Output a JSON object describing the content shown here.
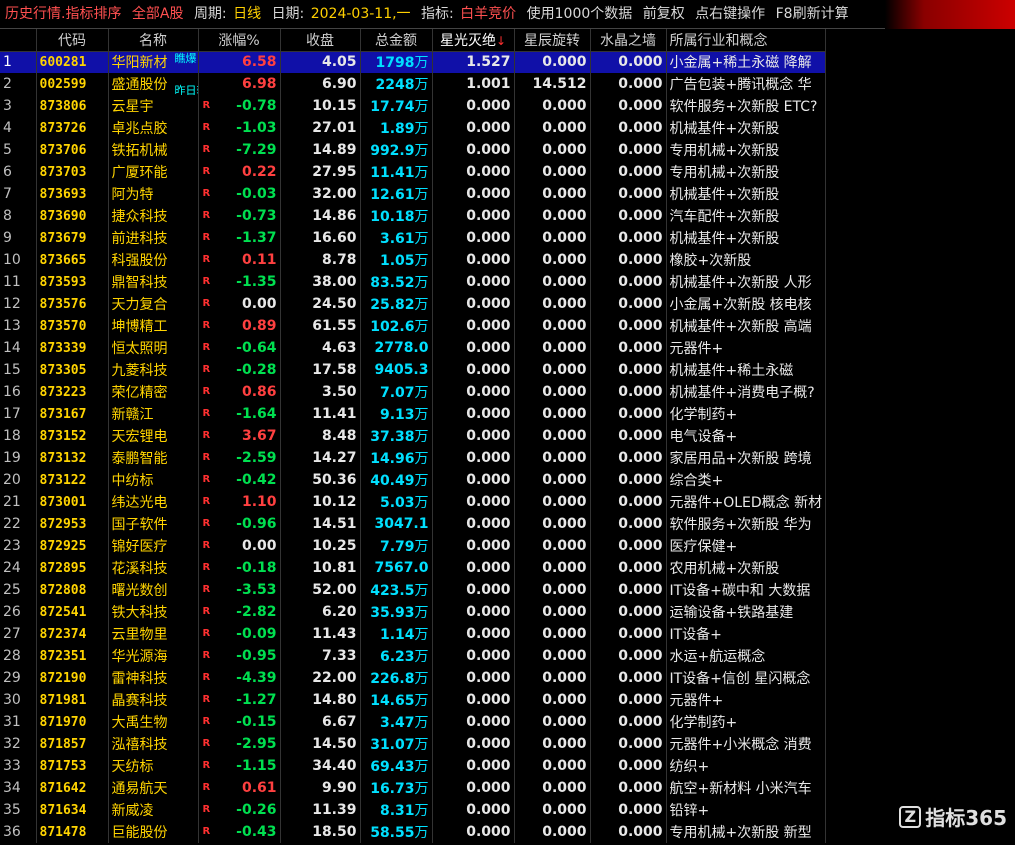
{
  "titlebar": {
    "section": "历史行情.指标排序",
    "market": "全部A股",
    "period_label": "周期:",
    "period_value": "日线",
    "date_label": "日期:",
    "date_value": "2024-03-11,一",
    "indicator_label": "指标:",
    "indicator_value": "白羊竞价",
    "data_count": "使用1000个数据",
    "adjust": "前复权",
    "rightclick": "点右键操作",
    "refresh": "F8刷新计算"
  },
  "columns": {
    "code": "代码",
    "name": "名称",
    "change": "涨幅%",
    "close": "收盘",
    "amount": "总金额",
    "c1": "星光灭绝",
    "c2": "星辰旋转",
    "c3": "水晶之墙",
    "industry": "所属行业和概念"
  },
  "sort_arrow": "↓",
  "r_flag": "R",
  "unit_wan": "万",
  "row1_tags": {
    "tag1": "瞧爆",
    "tag2": "昨日较弱"
  },
  "colors": {
    "up": "#ff4040",
    "down": "#00e050",
    "selected_row": "#1010a8",
    "code": "#ffd400",
    "amount": "#00e0ff"
  },
  "rows": [
    {
      "idx": "1",
      "code": "600281",
      "name": "华阳新材",
      "chg": "6.58",
      "dir": "up",
      "close": "4.05",
      "amt": "1798",
      "unit": "万",
      "c1": "1.527",
      "c2": "0.000",
      "c3": "0.000",
      "ind": "小金属+稀土永磁 降解",
      "r": false
    },
    {
      "idx": "2",
      "code": "002599",
      "name": "盛通股份",
      "chg": "6.98",
      "dir": "up",
      "close": "6.90",
      "amt": "2248",
      "unit": "万",
      "c1": "1.001",
      "c2": "14.512",
      "c3": "0.000",
      "ind": "广告包装+腾讯概念 华",
      "r": false
    },
    {
      "idx": "3",
      "code": "873806",
      "name": "云星宇",
      "chg": "-0.78",
      "dir": "down",
      "close": "10.15",
      "amt": "17.74",
      "unit": "万",
      "c1": "0.000",
      "c2": "0.000",
      "c3": "0.000",
      "ind": "软件服务+次新股 ETC?",
      "r": true
    },
    {
      "idx": "4",
      "code": "873726",
      "name": "卓兆点胶",
      "chg": "-1.03",
      "dir": "down",
      "close": "27.01",
      "amt": "1.89",
      "unit": "万",
      "c1": "0.000",
      "c2": "0.000",
      "c3": "0.000",
      "ind": "机械基件+次新股",
      "r": true
    },
    {
      "idx": "5",
      "code": "873706",
      "name": "铁拓机械",
      "chg": "-7.29",
      "dir": "down",
      "close": "14.89",
      "amt": "992.9",
      "unit": "万",
      "c1": "0.000",
      "c2": "0.000",
      "c3": "0.000",
      "ind": "专用机械+次新股",
      "r": true
    },
    {
      "idx": "6",
      "code": "873703",
      "name": "广厦环能",
      "chg": "0.22",
      "dir": "up",
      "close": "27.95",
      "amt": "11.41",
      "unit": "万",
      "c1": "0.000",
      "c2": "0.000",
      "c3": "0.000",
      "ind": "专用机械+次新股",
      "r": true
    },
    {
      "idx": "7",
      "code": "873693",
      "name": "阿为特",
      "chg": "-0.03",
      "dir": "down",
      "close": "32.00",
      "amt": "12.61",
      "unit": "万",
      "c1": "0.000",
      "c2": "0.000",
      "c3": "0.000",
      "ind": "机械基件+次新股",
      "r": true
    },
    {
      "idx": "8",
      "code": "873690",
      "name": "捷众科技",
      "chg": "-0.73",
      "dir": "down",
      "close": "14.86",
      "amt": "10.18",
      "unit": "万",
      "c1": "0.000",
      "c2": "0.000",
      "c3": "0.000",
      "ind": "汽车配件+次新股",
      "r": true
    },
    {
      "idx": "9",
      "code": "873679",
      "name": "前进科技",
      "chg": "-1.37",
      "dir": "down",
      "close": "16.60",
      "amt": "3.61",
      "unit": "万",
      "c1": "0.000",
      "c2": "0.000",
      "c3": "0.000",
      "ind": "机械基件+次新股",
      "r": true
    },
    {
      "idx": "10",
      "code": "873665",
      "name": "科强股份",
      "chg": "0.11",
      "dir": "up",
      "close": "8.78",
      "amt": "1.05",
      "unit": "万",
      "c1": "0.000",
      "c2": "0.000",
      "c3": "0.000",
      "ind": "橡胶+次新股",
      "r": true
    },
    {
      "idx": "11",
      "code": "873593",
      "name": "鼎智科技",
      "chg": "-1.35",
      "dir": "down",
      "close": "38.00",
      "amt": "83.52",
      "unit": "万",
      "c1": "0.000",
      "c2": "0.000",
      "c3": "0.000",
      "ind": "机械基件+次新股 人形",
      "r": true
    },
    {
      "idx": "12",
      "code": "873576",
      "name": "天力复合",
      "chg": "0.00",
      "dir": "flat",
      "close": "24.50",
      "amt": "25.82",
      "unit": "万",
      "c1": "0.000",
      "c2": "0.000",
      "c3": "0.000",
      "ind": "小金属+次新股 核电核",
      "r": true
    },
    {
      "idx": "13",
      "code": "873570",
      "name": "坤博精工",
      "chg": "0.89",
      "dir": "up",
      "close": "61.55",
      "amt": "102.6",
      "unit": "万",
      "c1": "0.000",
      "c2": "0.000",
      "c3": "0.000",
      "ind": "机械基件+次新股 高端",
      "r": true
    },
    {
      "idx": "14",
      "code": "873339",
      "name": "恒太照明",
      "chg": "-0.64",
      "dir": "down",
      "close": "4.63",
      "amt": "2778.0",
      "unit": "",
      "c1": "0.000",
      "c2": "0.000",
      "c3": "0.000",
      "ind": "元器件+",
      "r": true
    },
    {
      "idx": "15",
      "code": "873305",
      "name": "九菱科技",
      "chg": "-0.28",
      "dir": "down",
      "close": "17.58",
      "amt": "9405.3",
      "unit": "",
      "c1": "0.000",
      "c2": "0.000",
      "c3": "0.000",
      "ind": "机械基件+稀土永磁",
      "r": true
    },
    {
      "idx": "16",
      "code": "873223",
      "name": "荣亿精密",
      "chg": "0.86",
      "dir": "up",
      "close": "3.50",
      "amt": "7.07",
      "unit": "万",
      "c1": "0.000",
      "c2": "0.000",
      "c3": "0.000",
      "ind": "机械基件+消费电子概?",
      "r": true
    },
    {
      "idx": "17",
      "code": "873167",
      "name": "新赣江",
      "chg": "-1.64",
      "dir": "down",
      "close": "11.41",
      "amt": "9.13",
      "unit": "万",
      "c1": "0.000",
      "c2": "0.000",
      "c3": "0.000",
      "ind": "化学制药+",
      "r": true
    },
    {
      "idx": "18",
      "code": "873152",
      "name": "天宏锂电",
      "chg": "3.67",
      "dir": "up",
      "close": "8.48",
      "amt": "37.38",
      "unit": "万",
      "c1": "0.000",
      "c2": "0.000",
      "c3": "0.000",
      "ind": "电气设备+",
      "r": true
    },
    {
      "idx": "19",
      "code": "873132",
      "name": "泰鹏智能",
      "chg": "-2.59",
      "dir": "down",
      "close": "14.27",
      "amt": "14.96",
      "unit": "万",
      "c1": "0.000",
      "c2": "0.000",
      "c3": "0.000",
      "ind": "家居用品+次新股 跨境",
      "r": true
    },
    {
      "idx": "20",
      "code": "873122",
      "name": "中纺标",
      "chg": "-0.42",
      "dir": "down",
      "close": "50.36",
      "amt": "40.49",
      "unit": "万",
      "c1": "0.000",
      "c2": "0.000",
      "c3": "0.000",
      "ind": "综合类+",
      "r": true
    },
    {
      "idx": "21",
      "code": "873001",
      "name": "纬达光电",
      "chg": "1.10",
      "dir": "up",
      "close": "10.12",
      "amt": "5.03",
      "unit": "万",
      "c1": "0.000",
      "c2": "0.000",
      "c3": "0.000",
      "ind": "元器件+OLED概念 新材",
      "r": true
    },
    {
      "idx": "22",
      "code": "872953",
      "name": "国子软件",
      "chg": "-0.96",
      "dir": "down",
      "close": "14.51",
      "amt": "3047.1",
      "unit": "",
      "c1": "0.000",
      "c2": "0.000",
      "c3": "0.000",
      "ind": "软件服务+次新股 华为",
      "r": true
    },
    {
      "idx": "23",
      "code": "872925",
      "name": "锦好医疗",
      "chg": "0.00",
      "dir": "flat",
      "close": "10.25",
      "amt": "7.79",
      "unit": "万",
      "c1": "0.000",
      "c2": "0.000",
      "c3": "0.000",
      "ind": "医疗保健+",
      "r": true
    },
    {
      "idx": "24",
      "code": "872895",
      "name": "花溪科技",
      "chg": "-0.18",
      "dir": "down",
      "close": "10.81",
      "amt": "7567.0",
      "unit": "",
      "c1": "0.000",
      "c2": "0.000",
      "c3": "0.000",
      "ind": "农用机械+次新股",
      "r": true
    },
    {
      "idx": "25",
      "code": "872808",
      "name": "曙光数创",
      "chg": "-3.53",
      "dir": "down",
      "close": "52.00",
      "amt": "423.5",
      "unit": "万",
      "c1": "0.000",
      "c2": "0.000",
      "c3": "0.000",
      "ind": "IT设备+碳中和 大数据",
      "r": true
    },
    {
      "idx": "26",
      "code": "872541",
      "name": "铁大科技",
      "chg": "-2.82",
      "dir": "down",
      "close": "6.20",
      "amt": "35.93",
      "unit": "万",
      "c1": "0.000",
      "c2": "0.000",
      "c3": "0.000",
      "ind": "运输设备+铁路基建",
      "r": true
    },
    {
      "idx": "27",
      "code": "872374",
      "name": "云里物里",
      "chg": "-0.09",
      "dir": "down",
      "close": "11.43",
      "amt": "1.14",
      "unit": "万",
      "c1": "0.000",
      "c2": "0.000",
      "c3": "0.000",
      "ind": "IT设备+",
      "r": true
    },
    {
      "idx": "28",
      "code": "872351",
      "name": "华光源海",
      "chg": "-0.95",
      "dir": "down",
      "close": "7.33",
      "amt": "6.23",
      "unit": "万",
      "c1": "0.000",
      "c2": "0.000",
      "c3": "0.000",
      "ind": "水运+航运概念",
      "r": true
    },
    {
      "idx": "29",
      "code": "872190",
      "name": "雷神科技",
      "chg": "-4.39",
      "dir": "down",
      "close": "22.00",
      "amt": "226.8",
      "unit": "万",
      "c1": "0.000",
      "c2": "0.000",
      "c3": "0.000",
      "ind": "IT设备+信创 星闪概念",
      "r": true
    },
    {
      "idx": "30",
      "code": "871981",
      "name": "晶赛科技",
      "chg": "-1.27",
      "dir": "down",
      "close": "14.80",
      "amt": "14.65",
      "unit": "万",
      "c1": "0.000",
      "c2": "0.000",
      "c3": "0.000",
      "ind": "元器件+",
      "r": true
    },
    {
      "idx": "31",
      "code": "871970",
      "name": "大禹生物",
      "chg": "-0.15",
      "dir": "down",
      "close": "6.67",
      "amt": "3.47",
      "unit": "万",
      "c1": "0.000",
      "c2": "0.000",
      "c3": "0.000",
      "ind": "化学制药+",
      "r": true
    },
    {
      "idx": "32",
      "code": "871857",
      "name": "泓禧科技",
      "chg": "-2.95",
      "dir": "down",
      "close": "14.50",
      "amt": "31.07",
      "unit": "万",
      "c1": "0.000",
      "c2": "0.000",
      "c3": "0.000",
      "ind": "元器件+小米概念 消费",
      "r": true
    },
    {
      "idx": "33",
      "code": "871753",
      "name": "天纺标",
      "chg": "-1.15",
      "dir": "down",
      "close": "34.40",
      "amt": "69.43",
      "unit": "万",
      "c1": "0.000",
      "c2": "0.000",
      "c3": "0.000",
      "ind": "纺织+",
      "r": true
    },
    {
      "idx": "34",
      "code": "871642",
      "name": "通易航天",
      "chg": "0.61",
      "dir": "up",
      "close": "9.90",
      "amt": "16.73",
      "unit": "万",
      "c1": "0.000",
      "c2": "0.000",
      "c3": "0.000",
      "ind": "航空+新材料 小米汽车",
      "r": true
    },
    {
      "idx": "35",
      "code": "871634",
      "name": "新威凌",
      "chg": "-0.26",
      "dir": "down",
      "close": "11.39",
      "amt": "8.31",
      "unit": "万",
      "c1": "0.000",
      "c2": "0.000",
      "c3": "0.000",
      "ind": "铅锌+",
      "r": true
    },
    {
      "idx": "36",
      "code": "871478",
      "name": "巨能股份",
      "chg": "-0.43",
      "dir": "down",
      "close": "18.50",
      "amt": "58.55",
      "unit": "万",
      "c1": "0.000",
      "c2": "0.000",
      "c3": "0.000",
      "ind": "专用机械+次新股 新型",
      "r": true
    }
  ],
  "watermark": {
    "logo": "Z",
    "text": "指标365"
  }
}
